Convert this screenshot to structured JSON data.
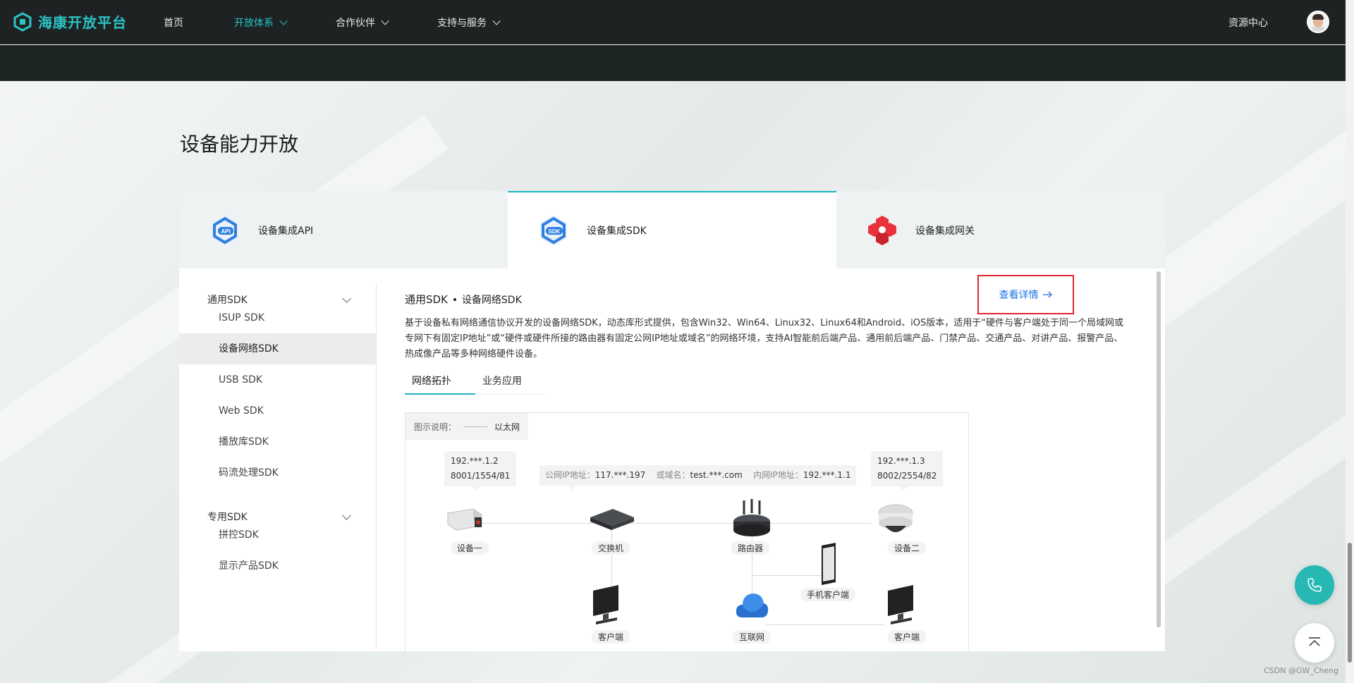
{
  "header": {
    "logo_text": "海康开放平台",
    "nav": [
      {
        "label": "首页",
        "dropdown": false,
        "active": false
      },
      {
        "label": "开放体系",
        "dropdown": true,
        "active": true
      },
      {
        "label": "合作伙伴",
        "dropdown": true,
        "active": false
      },
      {
        "label": "支持与服务",
        "dropdown": true,
        "active": false
      }
    ],
    "resource_center": "资源中心"
  },
  "section_title": "设备能力开放",
  "tabs": [
    {
      "label": "设备集成API",
      "icon": "api-icon",
      "active": false
    },
    {
      "label": "设备集成SDK",
      "icon": "sdk-icon",
      "active": true
    },
    {
      "label": "设备集成网关",
      "icon": "gateway-icon",
      "active": false
    }
  ],
  "sidebar": {
    "groups": [
      {
        "title": "通用SDK",
        "items": [
          "ISUP SDK",
          "设备网络SDK",
          "USB SDK",
          "Web SDK",
          "播放库SDK",
          "码流处理SDK"
        ]
      },
      {
        "title": "专用SDK",
        "items": [
          "拼控SDK",
          "显示产品SDK"
        ]
      }
    ],
    "active_item": "设备网络SDK"
  },
  "content": {
    "crumb_main": "通用SDK",
    "crumb_sub": "设备网络SDK",
    "detail_button": "查看详情",
    "description": "基于设备私有网络通信协议开发的设备网络SDK，动态库形式提供，包含Win32、Win64、Linux32、Linux64和Android、iOS版本，适用于“硬件与客户端处于同一个局域网或专网下有固定IP地址”或“硬件或硬件所接的路由器有固定公网IP地址或域名”的网络环境，支持AI智能前后端产品、通用前后端产品、门禁产品、交通产品、对讲产品、报警产品、热成像产品等多种网络硬件设备。",
    "subtabs": [
      "网络拓扑",
      "业务应用"
    ],
    "active_subtab": "网络拓扑"
  },
  "diagram": {
    "legend_label": "图示说明：",
    "legend_line": "以太网",
    "tip_device1": {
      "ip": "192.***.1.2",
      "ports": "8001/1554/81"
    },
    "tip_device2": {
      "ip": "192.***.1.3",
      "ports": "8002/2554/82"
    },
    "tip_router": {
      "public_label": "公网IP地址：",
      "public_ip": "117.***.197",
      "domain_label": "或域名：",
      "domain": "test.***.com",
      "lan_label": "内网IP地址：",
      "lan_ip": "192.***.1.1"
    },
    "labels": {
      "device1": "设备一",
      "switch": "交换机",
      "router": "路由器",
      "device2": "设备二",
      "mobile": "手机客户端",
      "client1": "客户端",
      "internet": "互联网",
      "client2": "客户端"
    }
  },
  "watermark": "CSDN @GW_Cheng",
  "colors": {
    "accent": "#1bb5bf",
    "header_bg": "#1f2223",
    "highlight_box": "#e0242b",
    "link": "#1a73e8"
  }
}
